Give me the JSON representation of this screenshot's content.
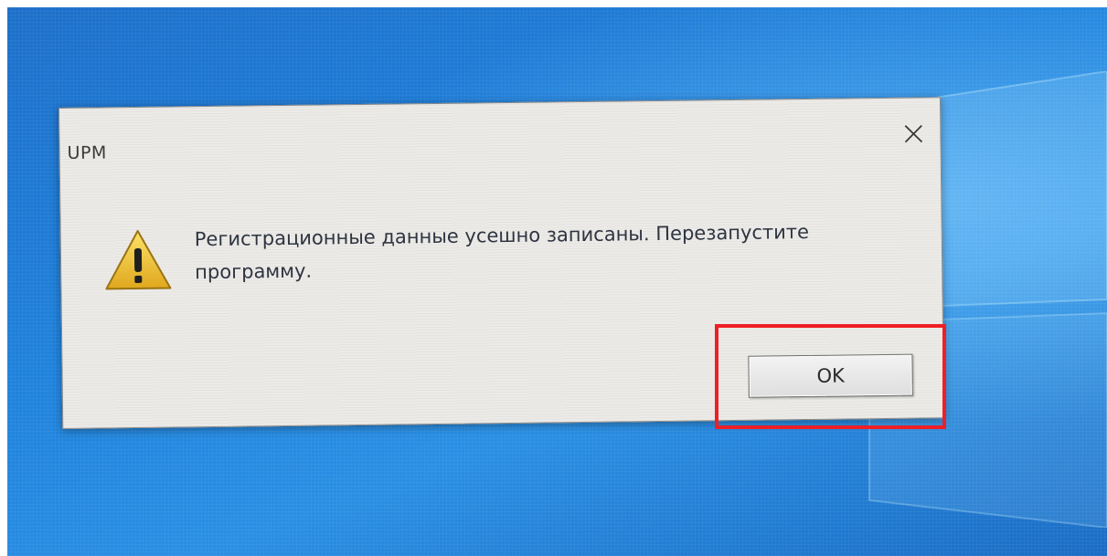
{
  "dialog": {
    "title": "UPM",
    "message_line1": "Регистрационные данные усешно записаны. Перезапустите",
    "message_line2": "программу.",
    "ok_label": "OK",
    "icon": "warning-icon",
    "close_icon": "close-icon"
  },
  "colors": {
    "desktop_blue": "#1f82dc",
    "dialog_bg": "#ecebe8",
    "highlight_red": "#ef1f25",
    "warning_yellow": "#f2c230"
  }
}
